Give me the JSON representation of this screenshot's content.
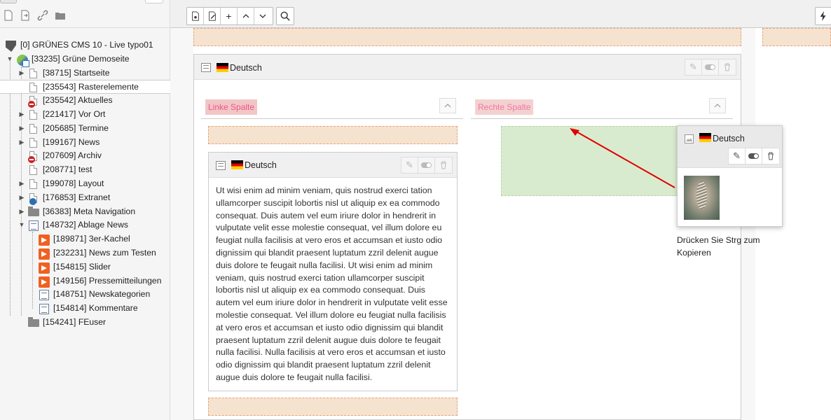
{
  "tree": {
    "root": "[0] GRÜNES CMS 10 - Live typo01",
    "items": [
      {
        "label": "[33235] Grüne Demoseite"
      },
      {
        "label": "[38715] Startseite"
      },
      {
        "label": "[235543] Rasterelemente"
      },
      {
        "label": "[235542] Aktuelles"
      },
      {
        "label": "[221417] Vor Ort"
      },
      {
        "label": "[205685] Termine"
      },
      {
        "label": "[199167] News"
      },
      {
        "label": "[207609] Archiv"
      },
      {
        "label": "[208771] test"
      },
      {
        "label": "[199078] Layout"
      },
      {
        "label": "[176853] Extranet"
      },
      {
        "label": "[36383] Meta Navigation"
      },
      {
        "label": "[148732] Ablage News"
      },
      {
        "label": "[189871] 3er-Kachel"
      },
      {
        "label": "[232231] News zum Testen"
      },
      {
        "label": "[154815] Slider"
      },
      {
        "label": "[149156] Pressemitteilungen"
      },
      {
        "label": "[148751] Newskategorien"
      },
      {
        "label": "[154814] Kommentare"
      },
      {
        "label": "[154241] FEuser"
      }
    ]
  },
  "content": {
    "outer_lang": "Deutsch",
    "left_column": "Linke Spalte",
    "right_column": "Rechte Spalte",
    "inner_lang": "Deutsch",
    "inner_text": "Ut wisi enim ad minim veniam, quis nostrud exerci tation ullamcorper suscipit lobortis nisl ut aliquip ex ea commodo consequat. Duis autem vel eum iriure dolor in hendrerit in vulputate velit esse molestie consequat, vel illum dolore eu feugiat nulla facilisis at vero eros et accumsan et iusto odio dignissim qui blandit praesent luptatum zzril delenit augue duis dolore te feugait nulla facilisi. Ut wisi enim ad minim veniam, quis nostrud exerci tation ullamcorper suscipit lobortis nisl ut aliquip ex ea commodo consequat. Duis autem vel eum iriure dolor in hendrerit in vulputate velit esse molestie consequat. Vel illum dolore eu feugiat nulla facilisis at vero eros et accumsan et iusto odio dignissim qui blandit praesent luptatum zzril delenit augue duis dolore te feugait nulla facilisi. Nulla facilisis at vero eros et accumsan et iusto odio dignissim qui blandit praesent luptatum zzril delenit augue duis dolore te feugait nulla facilisi.",
    "drag_lang": "Deutsch",
    "drag_hint": "Drücken Sie Strg zum Kopieren"
  },
  "colors": {
    "dropzone_fill": "#f6e3cf",
    "dropzone_border": "#e3a57c",
    "green_drop": "#d9ebcf",
    "arrow": "#e00000",
    "column_label_bg": "#f2c6c6"
  }
}
